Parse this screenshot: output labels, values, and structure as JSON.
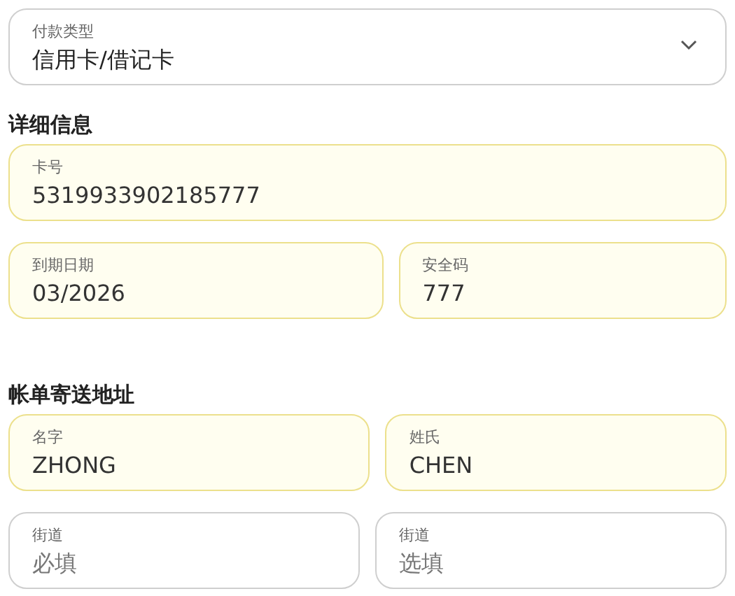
{
  "payment_type": {
    "label": "付款类型",
    "value": "信用卡/借记卡"
  },
  "sections": [
    {
      "heading": "详细信息",
      "rows": [
        [
          {
            "label": "卡号",
            "value": "5319933902185777",
            "autofilled": true
          }
        ],
        [
          {
            "label": "到期日期",
            "value": "03/2026",
            "autofilled": true
          },
          {
            "label": "安全码",
            "value": "777",
            "autofilled": true
          }
        ]
      ]
    },
    {
      "heading": "帐单寄送地址",
      "rows": [
        [
          {
            "label": "名字",
            "value": "ZHONG",
            "autofilled": true
          },
          {
            "label": "姓氏",
            "value": "CHEN",
            "autofilled": true
          }
        ],
        [
          {
            "label": "街道",
            "placeholder": "必填",
            "autofilled": false
          },
          {
            "label": "街道",
            "placeholder": "选填",
            "autofilled": false
          }
        ]
      ]
    }
  ]
}
